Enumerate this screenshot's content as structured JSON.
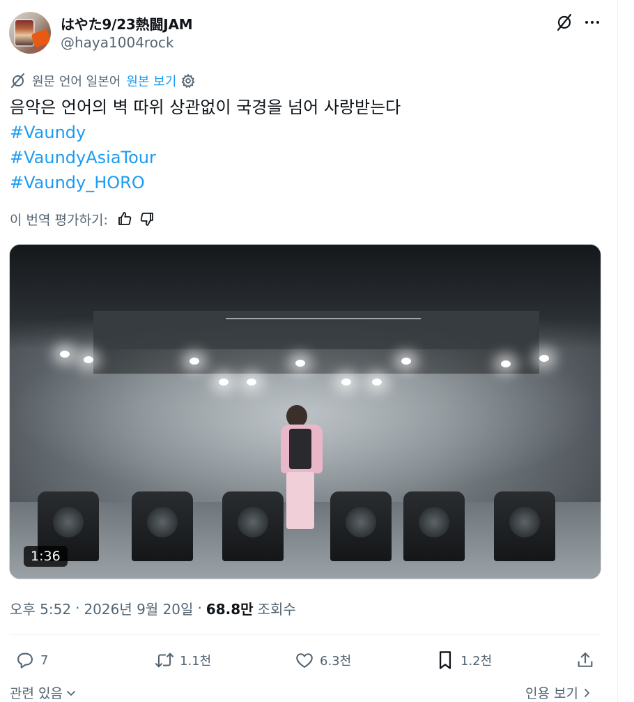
{
  "author": {
    "display_name": "はやた9/23熱闘JAM",
    "handle": "@haya1004rock"
  },
  "translation": {
    "source_label": "원문 언어 일본어",
    "show_original_label": "원본 보기"
  },
  "tweet": {
    "text": "음악은 언어의 벽 따위 상관없이 국경을 넘어 사랑받는다",
    "hashtags": [
      "#Vaundy",
      "#VaundyAsiaTour",
      "#Vaundy_HORO"
    ]
  },
  "rate_translation_label": "이 번역 평가하기:",
  "video": {
    "duration": "1:36"
  },
  "meta": {
    "time": "오후 5:52",
    "separator": "·",
    "date": "2026년 9월 20일",
    "views_count": "68.8만",
    "views_label": "조회수"
  },
  "actions": {
    "replies": "7",
    "retweets": "1.1천",
    "likes": "6.3천",
    "bookmarks": "1.2천"
  },
  "footer": {
    "related_label": "관련 있음",
    "quotes_label": "인용 보기"
  },
  "icons": {
    "grok": "grok-icon",
    "more": "more-icon",
    "translate": "translate-icon",
    "settings": "settings-gear-icon",
    "thumbs_up": "thumbs-up-icon",
    "thumbs_down": "thumbs-down-icon",
    "reply": "reply-icon",
    "retweet": "retweet-icon",
    "like": "heart-icon",
    "bookmark": "bookmark-icon",
    "share": "share-icon"
  },
  "colors": {
    "link": "#1d9bf0",
    "text_primary": "#0f1419",
    "text_secondary": "#536471"
  }
}
